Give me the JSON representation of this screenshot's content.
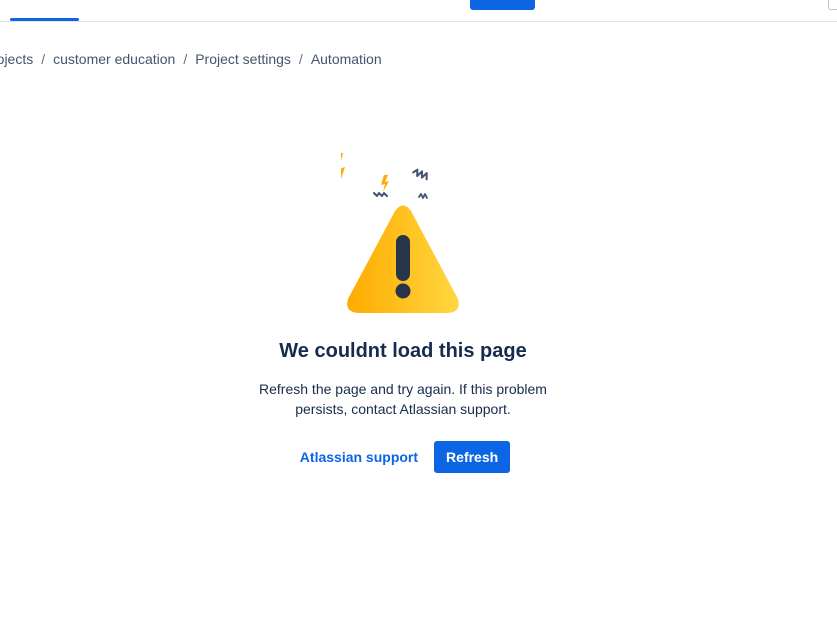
{
  "breadcrumbs": [
    {
      "label": "rojects"
    },
    {
      "label": "customer education"
    },
    {
      "label": "Project settings"
    },
    {
      "label": "Automation"
    }
  ],
  "breadcrumb_separator": "/",
  "error": {
    "icon": "warning-triangle-icon",
    "title": "We couldnt load this page",
    "description": "Refresh the page and try again. If this problem persists, contact Atlassian support.",
    "support_link": "Atlassian support",
    "refresh_button": "Refresh"
  },
  "colors": {
    "accent": "#0c66e4",
    "text": "#172b4d",
    "warning": "#ffc400"
  }
}
